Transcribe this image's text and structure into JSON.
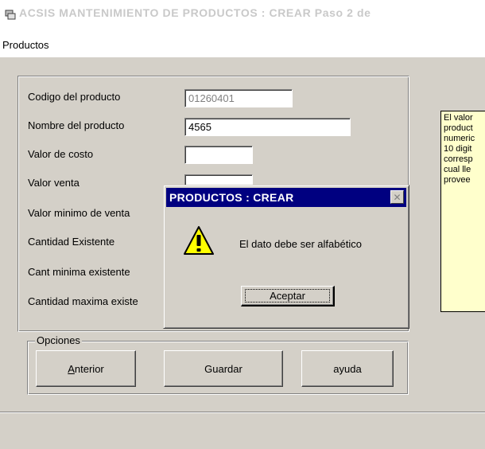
{
  "window": {
    "title": "ACSIS MANTENIMIENTO  DE PRODUCTOS   : CREAR  Paso 2 de"
  },
  "menu": {
    "items": [
      {
        "label": "Productos"
      }
    ]
  },
  "form": {
    "fields": [
      {
        "label": "Codigo del producto",
        "value": "01260401",
        "disabled": true
      },
      {
        "label": "Nombre del producto",
        "value": "4565"
      },
      {
        "label": "Valor  de costo",
        "value": ""
      },
      {
        "label": "Valor venta",
        "value": ""
      },
      {
        "label": "Valor minimo de venta"
      },
      {
        "label": "Cantidad Existente"
      },
      {
        "label": "Cant minima existente"
      },
      {
        "label": "Cantidad maxima existe"
      }
    ]
  },
  "info_panel": {
    "lines": [
      "El valor",
      "product",
      "numeric",
      "10 digit",
      "corresp",
      "cual lle",
      "provee"
    ]
  },
  "options": {
    "legend": "Opciones",
    "buttons": {
      "anterior_first": "A",
      "anterior_rest": "nterior",
      "guardar": "Guardar",
      "ayuda": "ayuda"
    }
  },
  "dialog": {
    "title": "PRODUCTOS : CREAR",
    "message": "El dato debe ser  alfabético",
    "ok_label": "Aceptar",
    "icon": "warning-icon",
    "close_icon": "close-icon"
  },
  "colors": {
    "dialog_title_bg": "#000080",
    "info_panel_bg": "#ffffcc",
    "face": "#d4d0c8"
  }
}
